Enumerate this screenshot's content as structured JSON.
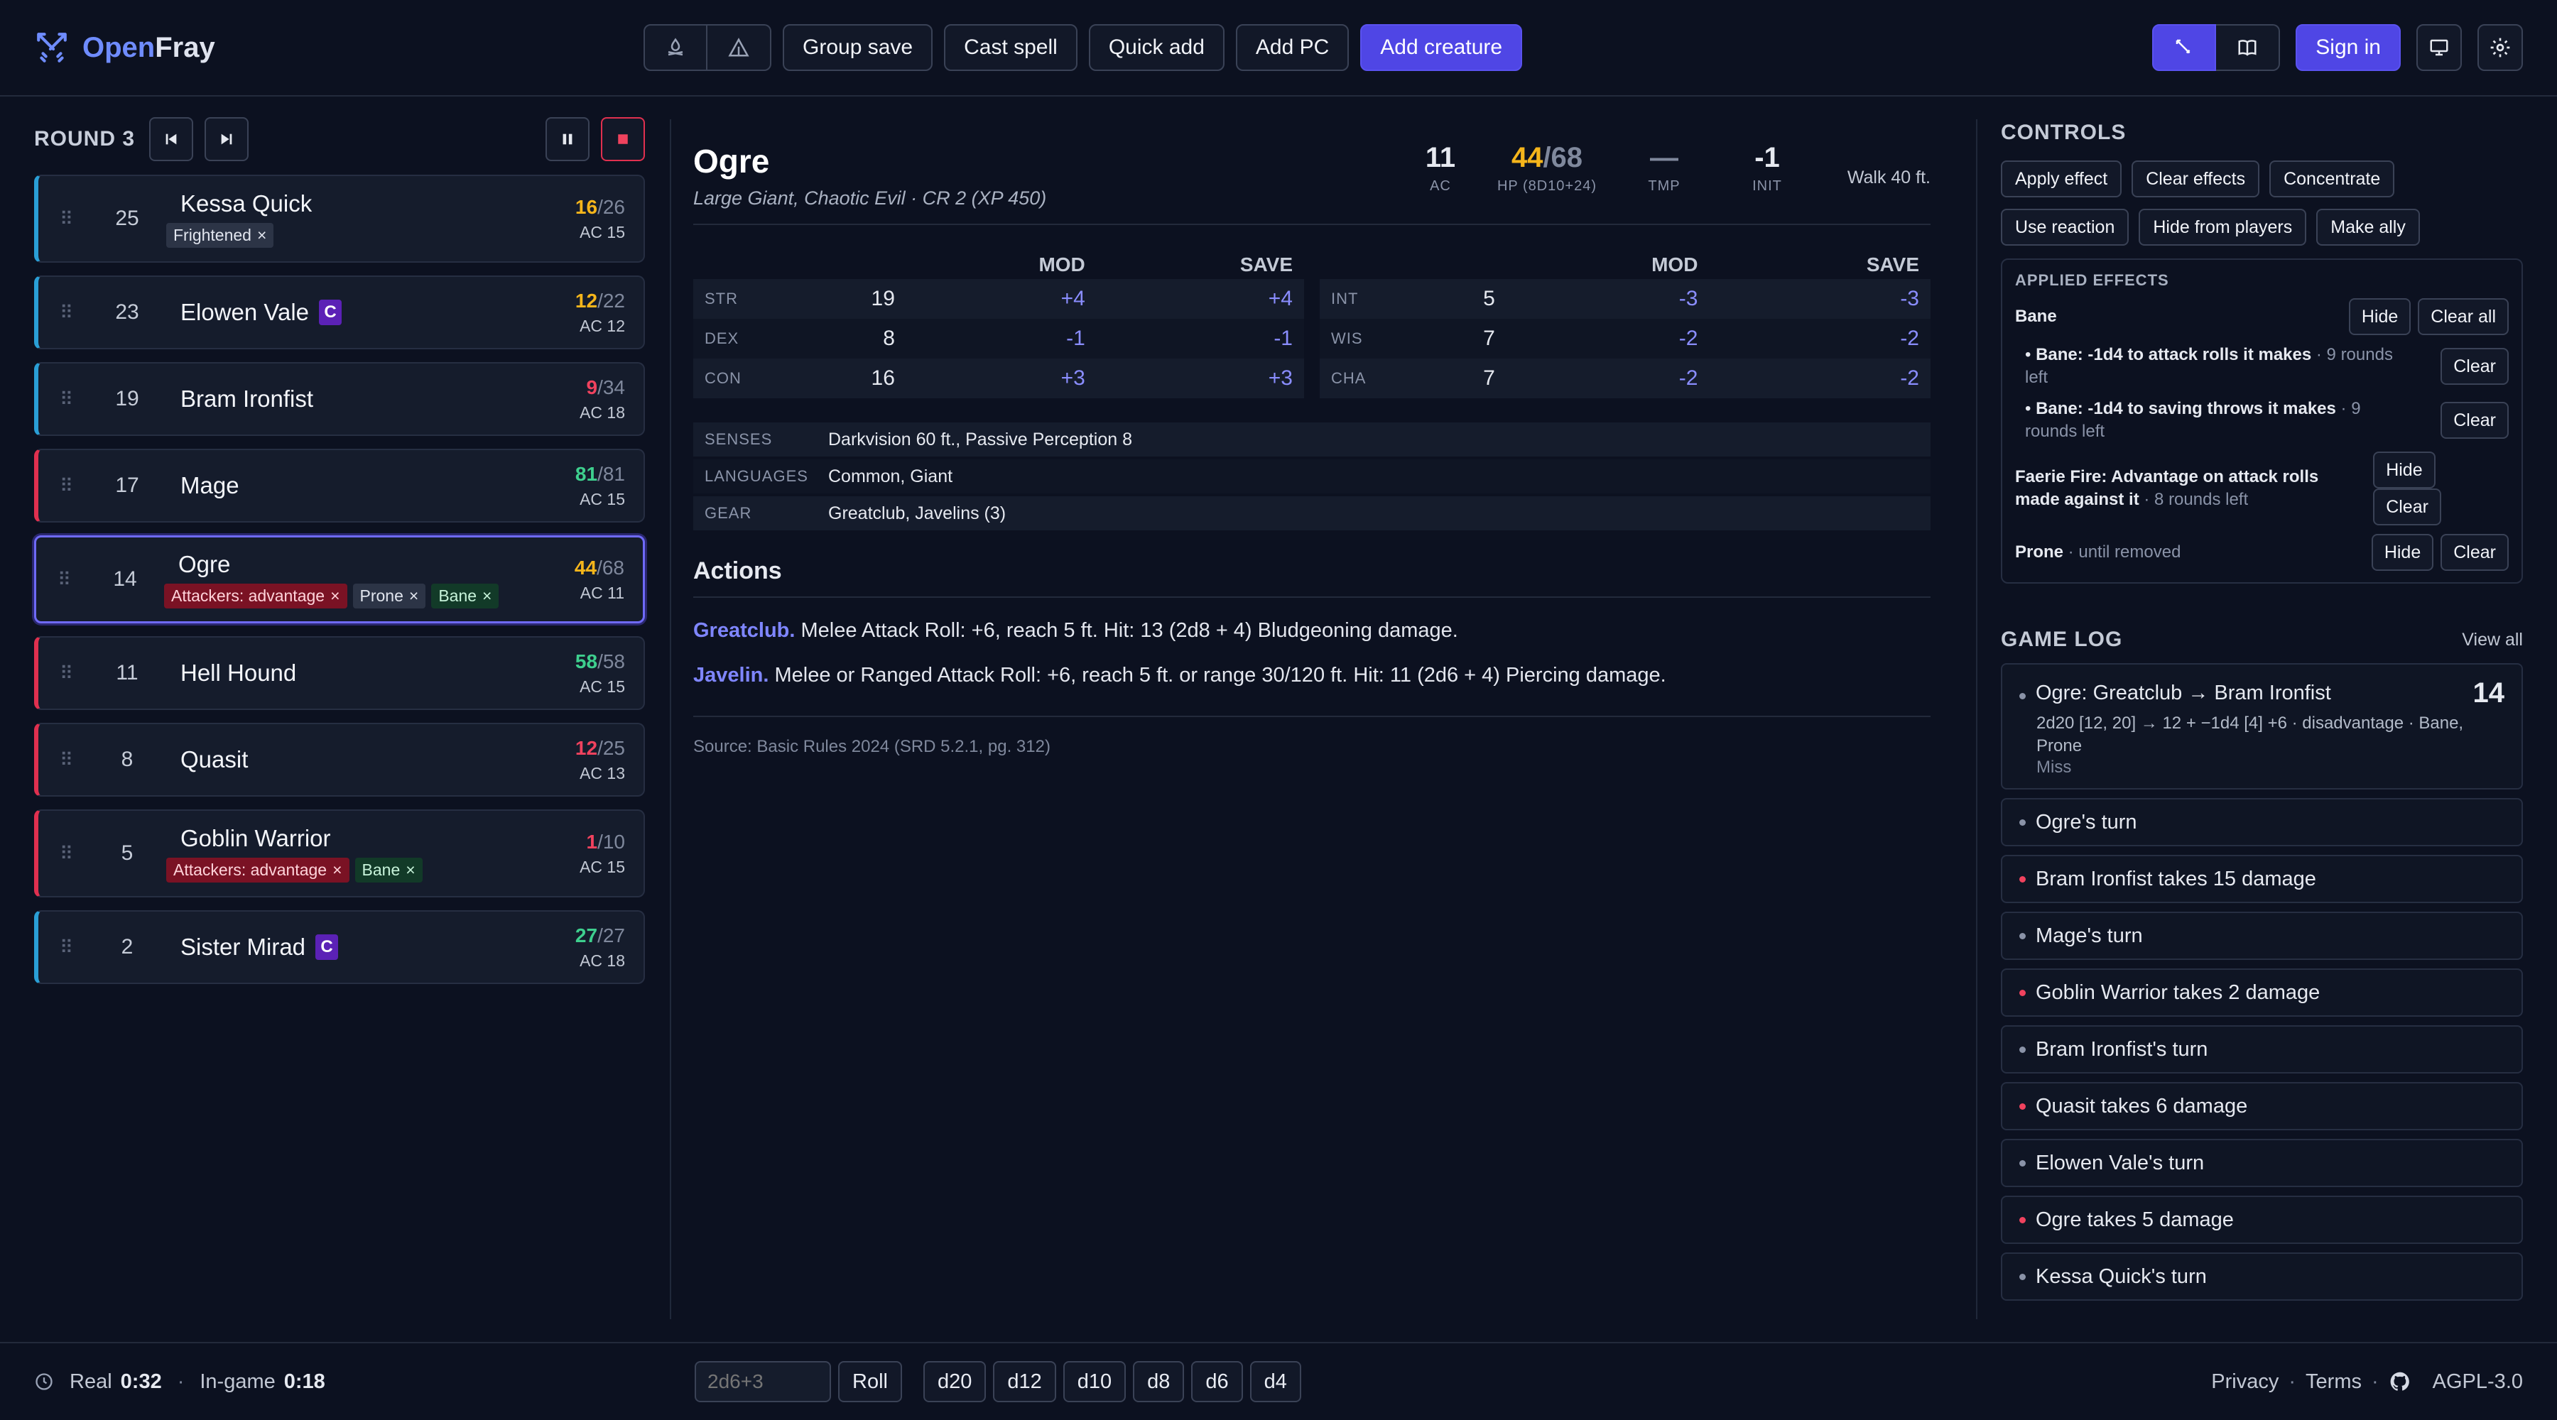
{
  "brand": {
    "open": "Open",
    "fray": "Fray"
  },
  "toolbar": {
    "group_save": "Group save",
    "cast_spell": "Cast spell",
    "quick_add": "Quick add",
    "add_pc": "Add PC",
    "add_creature": "Add creature",
    "sign_in": "Sign in"
  },
  "round": {
    "label": "ROUND 3"
  },
  "combatants": [
    {
      "init": "25",
      "name": "Kessa Quick",
      "hp": "16",
      "max": "/26",
      "ac": "AC 15",
      "hpColor": "yellow",
      "kind": "pc",
      "tags": [
        {
          "text": "Frightened",
          "style": "neutral"
        }
      ]
    },
    {
      "init": "23",
      "name": "Elowen Vale",
      "hp": "12",
      "max": "/22",
      "ac": "AC 12",
      "hpColor": "yellow",
      "kind": "pc",
      "badge": "C"
    },
    {
      "init": "19",
      "name": "Bram Ironfist",
      "hp": "9",
      "max": "/34",
      "ac": "AC 18",
      "hpColor": "red",
      "kind": "pc"
    },
    {
      "init": "17",
      "name": "Mage",
      "hp": "81",
      "max": "/81",
      "ac": "AC 15",
      "hpColor": "green",
      "kind": "mon"
    },
    {
      "init": "14",
      "name": "Ogre",
      "hp": "44",
      "max": "/68",
      "ac": "AC 11",
      "hpColor": "yellow",
      "kind": "mon",
      "active": true,
      "tags": [
        {
          "text": "Attackers: advantage",
          "style": "redt"
        },
        {
          "text": "Prone",
          "style": "neutral"
        },
        {
          "text": "Bane",
          "style": "greent"
        }
      ]
    },
    {
      "init": "11",
      "name": "Hell Hound",
      "hp": "58",
      "max": "/58",
      "ac": "AC 15",
      "hpColor": "green",
      "kind": "mon"
    },
    {
      "init": "8",
      "name": "Quasit",
      "hp": "12",
      "max": "/25",
      "ac": "AC 13",
      "hpColor": "red",
      "kind": "mon"
    },
    {
      "init": "5",
      "name": "Goblin Warrior",
      "hp": "1",
      "max": "/10",
      "ac": "AC 15",
      "hpColor": "red",
      "kind": "mon",
      "tags": [
        {
          "text": "Attackers: advantage",
          "style": "redt"
        },
        {
          "text": "Bane",
          "style": "greent"
        }
      ]
    },
    {
      "init": "2",
      "name": "Sister Mirad",
      "hp": "27",
      "max": "/27",
      "ac": "AC 18",
      "hpColor": "green",
      "kind": "pc",
      "badge": "C"
    }
  ],
  "creature": {
    "name": "Ogre",
    "subtitle": "Large Giant, Chaotic Evil · CR 2 (XP 450)",
    "ac": "11",
    "ac_label": "AC",
    "hp": "44",
    "hp_max": "/68",
    "hp_label": "HP (8D10+24)",
    "tmp": "—",
    "tmp_label": "TMP",
    "init": "-1",
    "init_label": "INIT",
    "speed": "Walk 40 ft.",
    "col_mod": "MOD",
    "col_save": "SAVE",
    "abilities_left": [
      {
        "k": "STR",
        "score": "19",
        "mod": "+4",
        "save": "+4"
      },
      {
        "k": "DEX",
        "score": "8",
        "mod": "-1",
        "save": "-1"
      },
      {
        "k": "CON",
        "score": "16",
        "mod": "+3",
        "save": "+3"
      }
    ],
    "abilities_right": [
      {
        "k": "INT",
        "score": "5",
        "mod": "-3",
        "save": "-3"
      },
      {
        "k": "WIS",
        "score": "7",
        "mod": "-2",
        "save": "-2"
      },
      {
        "k": "CHA",
        "score": "7",
        "mod": "-2",
        "save": "-2"
      }
    ],
    "senses_label": "SENSES",
    "senses": "Darkvision 60 ft., Passive Perception 8",
    "languages_label": "LANGUAGES",
    "languages": "Common, Giant",
    "gear_label": "GEAR",
    "gear": "Greatclub, Javelins (3)",
    "actions_title": "Actions",
    "action1_name": "Greatclub.",
    "action1_text": " Melee Attack Roll: +6, reach 5 ft. Hit: 13 (2d8 + 4) Bludgeoning damage.",
    "action2_name": "Javelin.",
    "action2_text": " Melee or Ranged Attack Roll: +6, reach 5 ft. or range 30/120 ft. Hit: 11 (2d6 + 4) Piercing damage.",
    "source": "Source: Basic Rules 2024 (SRD 5.2.1, pg. 312)"
  },
  "controls": {
    "title": "CONTROLS",
    "apply_effect": "Apply effect",
    "clear_effects": "Clear effects",
    "concentrate": "Concentrate",
    "use_reaction": "Use reaction",
    "hide_from_players": "Hide from players",
    "make_ally": "Make ally",
    "applied_title": "APPLIED EFFECTS",
    "bane": "Bane",
    "hide": "Hide",
    "clear_all": "Clear all",
    "clear": "Clear",
    "bane1_b": "Bane: -1d4 to attack rolls it makes",
    "bane1_r": " · 9 rounds left",
    "bane2_b": "Bane: -1d4 to saving throws it makes",
    "bane2_r": " · 9 rounds left",
    "ff_b": "Faerie Fire: Advantage on attack rolls made against it",
    "ff_r": " · 8 rounds left",
    "prone_b": "Prone",
    "prone_r": " · until removed"
  },
  "log": {
    "title": "GAME LOG",
    "view_all": "View all",
    "featured_title": "Ogre: Greatclub → Bram Ironfist",
    "featured_total": "14",
    "featured_detail": "2d20 [12, 20] → 12 + −1d4 [4] +6 · disadvantage · Bane, Prone",
    "featured_result": "Miss",
    "entries": [
      {
        "text": "Ogre's turn",
        "red": false
      },
      {
        "text": "Bram Ironfist takes 15 damage",
        "red": true
      },
      {
        "text": "Mage's turn",
        "red": false
      },
      {
        "text": "Goblin Warrior takes 2 damage",
        "red": true
      },
      {
        "text": "Bram Ironfist's turn",
        "red": false
      },
      {
        "text": "Quasit takes 6 damage",
        "red": true
      },
      {
        "text": "Elowen Vale's turn",
        "red": false
      },
      {
        "text": "Ogre takes 5 damage",
        "red": true
      },
      {
        "text": "Kessa Quick's turn",
        "red": false
      }
    ]
  },
  "footer": {
    "real_label": "Real",
    "real": "0:32",
    "sep": "·",
    "ingame_label": "In-game",
    "ingame": "0:18",
    "dice_placeholder": "2d6+3",
    "roll": "Roll",
    "dice": [
      "d20",
      "d12",
      "d10",
      "d8",
      "d6",
      "d4"
    ],
    "privacy": "Privacy",
    "terms": "Terms",
    "license": "AGPL-3.0"
  }
}
